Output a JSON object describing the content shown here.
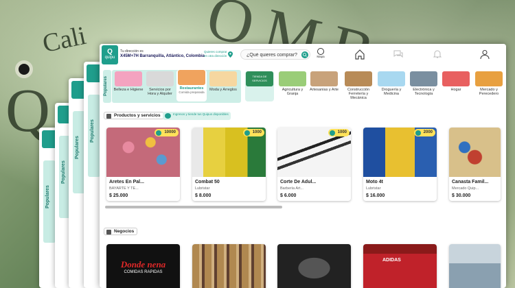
{
  "background": {
    "word_cali": "Cali",
    "word_om": "OMB",
    "word_q": "Q"
  },
  "ghosts": [
    {
      "tab": "Populares"
    },
    {
      "tab": "Populares"
    },
    {
      "tab": "Populares"
    },
    {
      "tab": "Populares"
    }
  ],
  "header": {
    "logo_text": "quipu",
    "address_label": "Tu dirección es",
    "address_value": "X45M+7H Barranquilla, Atlántico, Colombia",
    "other_address": "Quieres comprar en otra dirección",
    "search_placeholder": "¿Qué quieres comprar?",
    "mapa_label": "Mapa"
  },
  "categories": {
    "tab_label": "Populares",
    "popular": [
      {
        "label": "Belleza e Higiene",
        "color": "#f4a3c0"
      },
      {
        "label": "Servicios por Hora y Alquiler",
        "color": "#d9d9d9"
      },
      {
        "label": "Restaurantes",
        "sub": "Comida preparada",
        "color": "#f0a35e",
        "selected": true
      },
      {
        "label": "Moda y Arreglos",
        "color": "#f6d7a0"
      }
    ],
    "others": [
      {
        "label": "TIENDA DE SERVICIOS",
        "color": "#2f8f5a"
      },
      {
        "label": "Agricultura y Granja",
        "color": "#9acd78"
      },
      {
        "label": "Artesanías y Arte",
        "color": "#c8a27a"
      },
      {
        "label": "Construcción Ferretería y Mecánica",
        "color": "#b88b57"
      },
      {
        "label": "Droguería y Medicina",
        "color": "#a8d8f0"
      },
      {
        "label": "Electrónica y Tecnología",
        "color": "#7a8fa0"
      },
      {
        "label": "Hogar",
        "color": "#e86060"
      },
      {
        "label": "Mercado y Perecedero",
        "color": "#e8a040"
      }
    ]
  },
  "products_section": {
    "label": "Productos y servicios",
    "quipus_badge": "Ingresos y tiende tus Quipus disponibles",
    "items": [
      {
        "name": "Aretes En Pal...",
        "store": "BAYARTE Y TE...",
        "price": "$ 25.000",
        "badge": "10000",
        "color": "#c46a7a"
      },
      {
        "name": "Combat 50",
        "store": "Lubristar",
        "price": "$ 8.000",
        "badge": "1000",
        "color": "#e7d040"
      },
      {
        "name": "Corte De Adul...",
        "store": "Barbería Art...",
        "price": "$ 6.000",
        "badge": "1000",
        "color": "#e9e9e9"
      },
      {
        "name": "Moto 4t",
        "store": "Lubristar",
        "price": "$ 16.000",
        "badge": "2000",
        "color": "#2a5fb0"
      },
      {
        "name": "Canasta Famil...",
        "store": "Mercado Quip...",
        "price": "$ 30.000",
        "badge": "",
        "color": "#d8c08a"
      }
    ]
  },
  "business_section": {
    "label": "Negocios",
    "items": [
      {
        "title": "Donde nena",
        "subtitle": "COMIDAS RAPIDAS",
        "color": "#111111"
      },
      {
        "title": "",
        "subtitle": "",
        "color": "#b08850"
      },
      {
        "title": "",
        "subtitle": "",
        "color": "#222222"
      },
      {
        "title": "ADIDAS",
        "subtitle": "",
        "color": "#c0222a"
      },
      {
        "title": "",
        "subtitle": "",
        "color": "#8aa0b0"
      }
    ]
  }
}
